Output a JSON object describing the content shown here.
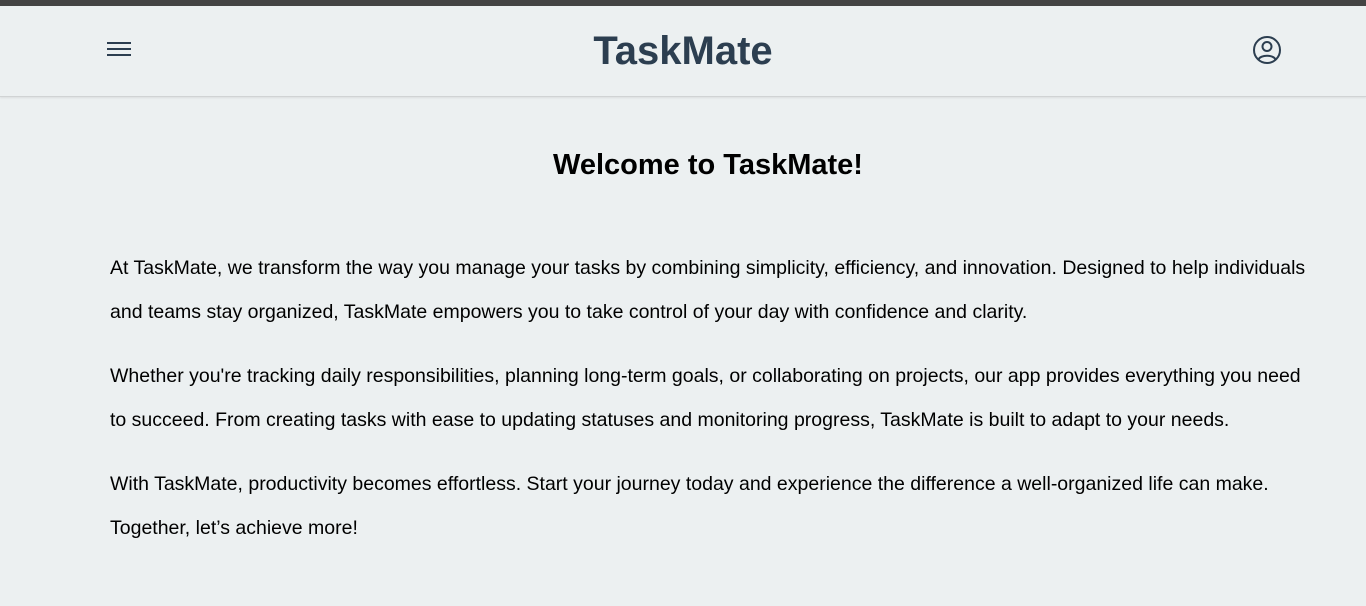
{
  "app": {
    "title": "TaskMate"
  },
  "header": {
    "menu_icon": "hamburger-menu-icon",
    "profile_icon": "user-circle-icon"
  },
  "main": {
    "heading": "Welcome to TaskMate!",
    "paragraphs": [
      "At TaskMate, we transform the way you manage your tasks by combining simplicity, efficiency, and innovation. Designed to help individuals and teams stay organized, TaskMate empowers you to take control of your day with confidence and clarity.",
      "Whether you're tracking daily responsibilities, planning long-term goals, or collaborating on projects, our app provides everything you need to succeed. From creating tasks with ease to updating statuses and monitoring progress, TaskMate is built to adapt to your needs.",
      "With TaskMate, productivity becomes effortless. Start your journey today and experience the difference a well-organized life can make. Together, let’s achieve more!"
    ]
  },
  "colors": {
    "background": "#ecf0f1",
    "brand": "#2c3e50",
    "top_strip": "#444444"
  }
}
